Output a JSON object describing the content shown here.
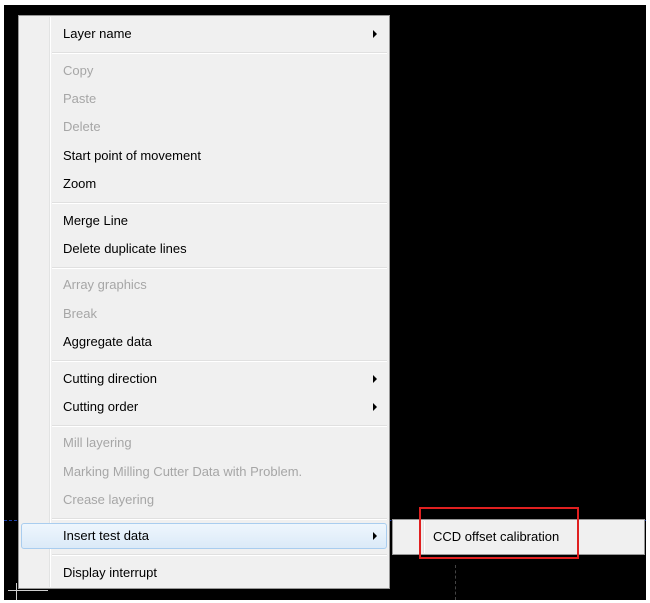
{
  "context_menu": {
    "items": [
      {
        "label": "Layer name",
        "disabled": false,
        "submenu": true
      },
      {
        "label": "Copy",
        "disabled": true,
        "submenu": false
      },
      {
        "label": "Paste",
        "disabled": true,
        "submenu": false
      },
      {
        "label": "Delete",
        "disabled": true,
        "submenu": false
      },
      {
        "label": "Start point of movement",
        "disabled": false,
        "submenu": false
      },
      {
        "label": "Zoom",
        "disabled": false,
        "submenu": false
      },
      {
        "label": "Merge Line",
        "disabled": false,
        "submenu": false
      },
      {
        "label": "Delete duplicate lines",
        "disabled": false,
        "submenu": false
      },
      {
        "label": "Array graphics",
        "disabled": true,
        "submenu": false
      },
      {
        "label": "Break",
        "disabled": true,
        "submenu": false
      },
      {
        "label": "Aggregate data",
        "disabled": false,
        "submenu": false
      },
      {
        "label": "Cutting direction",
        "disabled": false,
        "submenu": true
      },
      {
        "label": "Cutting order",
        "disabled": false,
        "submenu": true
      },
      {
        "label": "Mill layering",
        "disabled": true,
        "submenu": false
      },
      {
        "label": "Marking Milling Cutter Data with Problem.",
        "disabled": true,
        "submenu": false
      },
      {
        "label": "Crease layering",
        "disabled": true,
        "submenu": false
      },
      {
        "label": "Insert test data",
        "disabled": false,
        "submenu": true,
        "highlighted": true
      },
      {
        "label": "Display interrupt",
        "disabled": false,
        "submenu": false
      }
    ]
  },
  "submenu": {
    "items": [
      {
        "label": "CCD offset calibration"
      }
    ]
  },
  "colors": {
    "canvas_background": "#000000",
    "menu_background": "#f0f0f0",
    "disabled_text": "#a6a6a6",
    "highlight": "#dbeaf8",
    "annotation_box": "#e02020"
  },
  "icons": {
    "submenu_arrow": "chevron-right-icon"
  }
}
